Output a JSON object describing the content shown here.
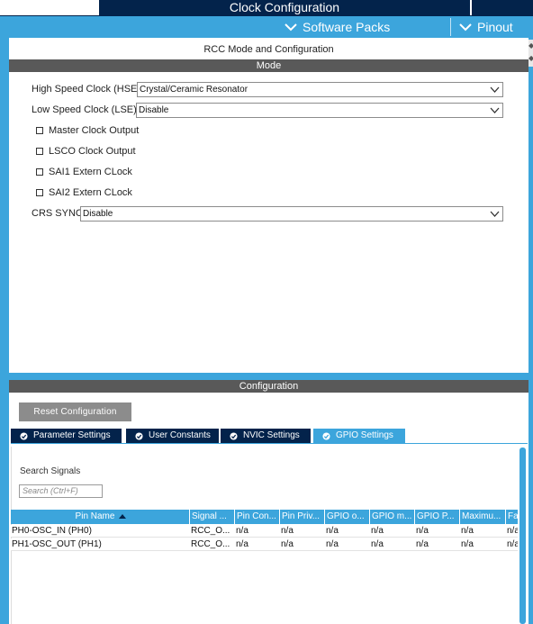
{
  "header": {
    "title": "Clock Configuration"
  },
  "menubar": {
    "software_packs": "Software Packs",
    "pinout": "Pinout"
  },
  "panel": {
    "title": "RCC Mode and Configuration",
    "mode_section": "Mode",
    "config_section": "Configuration"
  },
  "mode": {
    "hse_label": "High Speed Clock (HSE)",
    "hse_value": "Crystal/Ceramic Resonator",
    "lse_label": "Low Speed Clock (LSE)",
    "lse_value": "Disable",
    "checkboxes": [
      {
        "label": "Master Clock Output",
        "checked": false
      },
      {
        "label": "LSCO Clock Output",
        "checked": false
      },
      {
        "label": "SAI1 Extern CLock",
        "checked": false
      },
      {
        "label": "SAI2 Extern CLock",
        "checked": false
      }
    ],
    "crs_label": "CRS SYNC",
    "crs_value": "Disable"
  },
  "config": {
    "reset_button": "Reset Configuration",
    "tabs": [
      {
        "label": "Parameter Settings",
        "active": false
      },
      {
        "label": "User Constants",
        "active": false
      },
      {
        "label": "NVIC Settings",
        "active": false
      },
      {
        "label": "GPIO Settings",
        "active": true
      }
    ],
    "search_label": "Search Signals",
    "search_placeholder": "Search (Ctrl+F)",
    "table": {
      "columns": [
        "Pin Name",
        "Signal ...",
        "Pin Con...",
        "Pin Priv...",
        "GPIO o...",
        "GPIO m...",
        "GPIO P...",
        "Maximu...",
        "Fa"
      ],
      "rows": [
        [
          "PH0-OSC_IN (PH0)",
          "RCC_O...",
          "n/a",
          "n/a",
          "n/a",
          "n/a",
          "n/a",
          "n/a",
          "n/a"
        ],
        [
          "PH1-OSC_OUT (PH1)",
          "RCC_O...",
          "n/a",
          "n/a",
          "n/a",
          "n/a",
          "n/a",
          "n/a",
          "n/a"
        ]
      ]
    }
  },
  "colors": {
    "navy": "#03234b",
    "accent": "#3ca5dc",
    "section_bar": "#595959",
    "button_gray": "#8c8c8c"
  }
}
